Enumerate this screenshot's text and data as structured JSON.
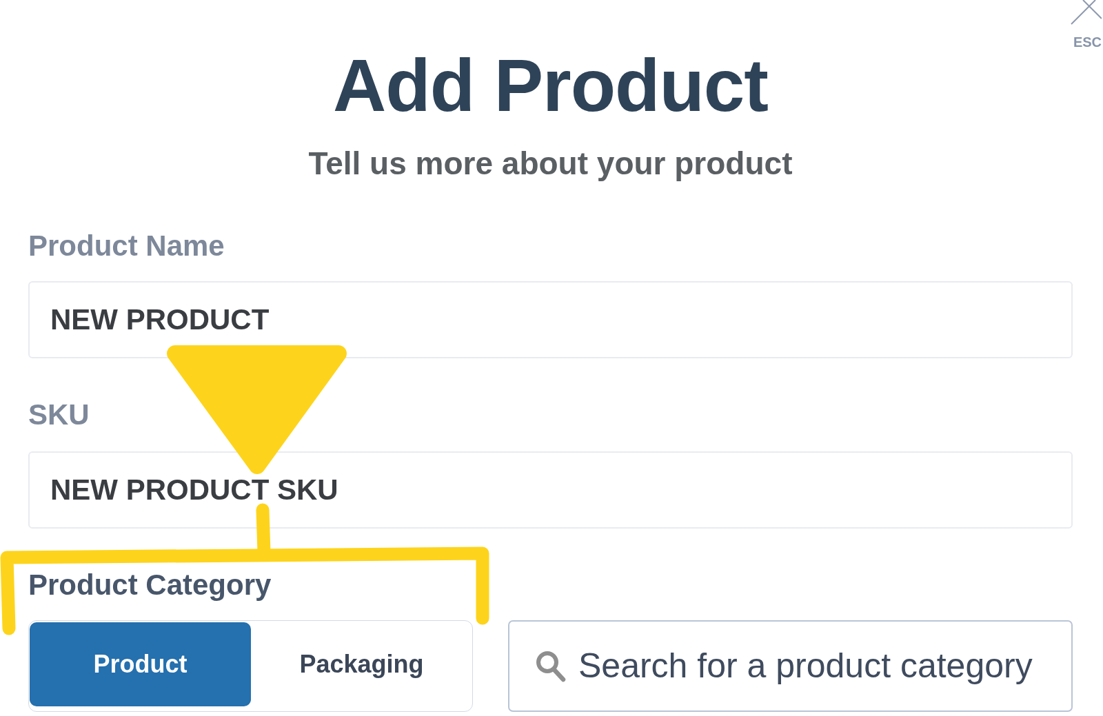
{
  "dialog": {
    "close": {
      "label": "ESC"
    },
    "title": "Add Product",
    "subtitle": "Tell us more about your product",
    "fields": [
      {
        "label": "Product Name",
        "value": "NEW PRODUCT"
      },
      {
        "label": "SKU",
        "value": "NEW PRODUCT SKU"
      }
    ],
    "category": {
      "label": "Product Category",
      "options": [
        {
          "label": "Product",
          "selected": true
        },
        {
          "label": "Packaging",
          "selected": false
        }
      ],
      "search": {
        "placeholder": "Search for a product category"
      }
    }
  }
}
